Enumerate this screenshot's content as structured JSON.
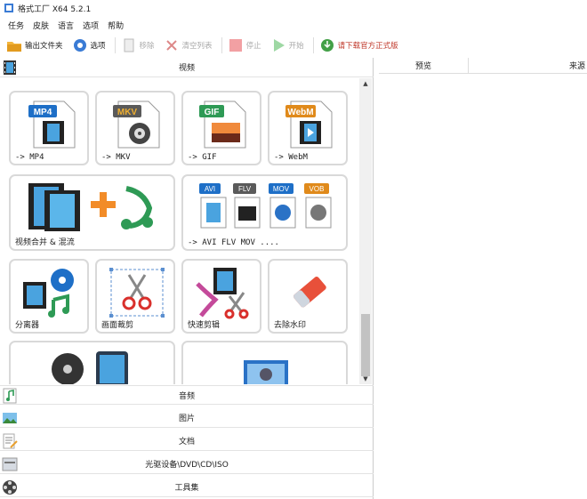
{
  "window": {
    "title": "格式工厂 X64 5.2.1"
  },
  "menu": [
    "任务",
    "皮肤",
    "语言",
    "选项",
    "帮助"
  ],
  "toolbar": {
    "output_folder": "输出文件夹",
    "options": "选项",
    "remove": "移除",
    "clear_list": "清空列表",
    "stop": "停止",
    "start": "开始",
    "download_official": "请下载官方正式版"
  },
  "categories": {
    "video": "视频",
    "audio": "音频",
    "picture": "图片",
    "document": "文档",
    "disc": "光驱设备\\DVD\\CD\\ISO",
    "tools": "工具集"
  },
  "tiles": {
    "mp4": {
      "label": "-> MP4",
      "badge": "MP4"
    },
    "mkv": {
      "label": "-> MKV",
      "badge": "MKV"
    },
    "gif": {
      "label": "-> GIF",
      "badge": "GIF"
    },
    "webm": {
      "label": "-> WebM",
      "badge": "WebM"
    },
    "merge": {
      "label": "视频合并 & 混流"
    },
    "multi": {
      "label": "-> AVI FLV MOV ....",
      "badges": [
        "AVI",
        "FLV",
        "MOV",
        "VOB"
      ]
    },
    "splitter": {
      "label": "分离器"
    },
    "crop": {
      "label": "画面裁剪"
    },
    "quick_cut": {
      "label": "快速剪辑"
    },
    "watermark": {
      "label": "去除水印"
    }
  },
  "right_panel": {
    "col_preview": "预览",
    "col_source": "来源"
  },
  "colors": {
    "mp4": "#1e6fc7",
    "mkv": "#5a5a5a",
    "gif": "#2e9a55",
    "webm": "#e08a1b",
    "tile_border": "#d9d9d9",
    "start_green": "#3cb04a",
    "stop_red": "#e8444a"
  }
}
